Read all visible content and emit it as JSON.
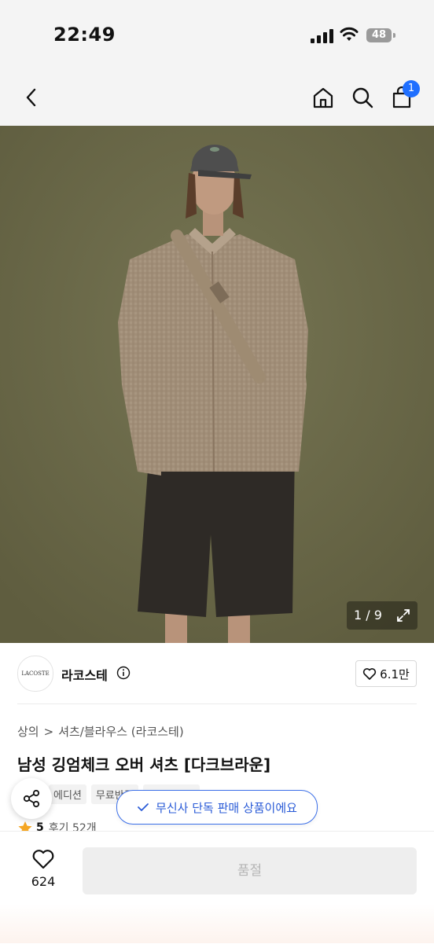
{
  "status_bar": {
    "time": "22:49",
    "battery": "48"
  },
  "nav": {
    "cart_badge": "1",
    "icons": [
      "back-icon",
      "home-icon",
      "search-icon",
      "cart-icon"
    ]
  },
  "gallery": {
    "counter": "1 / 9"
  },
  "brand": {
    "logo_text": "LACOSTE",
    "name": "라코스테",
    "likes": "6.1만"
  },
  "breadcrumb": {
    "category": "상의",
    "separator": ">",
    "subcategory": "셔츠/블라우스 (라코스테)"
  },
  "product": {
    "title": "남성 깅엄체크 오버 셔츠 [다크브라운]",
    "tags": [
      "에디션",
      "무료반품",
      "무신사단독"
    ],
    "rating": "5",
    "reviews": "후기 52개"
  },
  "toast": {
    "text": "무신사 단독 판매 상품이에요"
  },
  "bottom": {
    "wish_count": "624",
    "buy_label": "품절"
  },
  "colors": {
    "accent": "#1f6fff",
    "toast_blue": "#2a5bd7",
    "hero_bg": "#6d6b4a"
  }
}
